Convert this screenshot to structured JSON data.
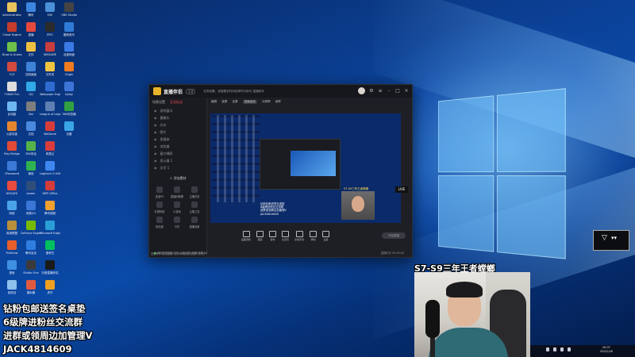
{
  "desktop_icons": [
    {
      "label": "Administrator",
      "color": "#e7c55c"
    },
    {
      "label": "Cheat Engine",
      "color": "#c43c2c"
    },
    {
      "label": "Draw & Guess",
      "color": "#6cc04a"
    },
    {
      "label": "V13",
      "color": "#d24a3f"
    },
    {
      "label": "736407?ol.",
      "color": "#dddddd"
    },
    {
      "label": "此电脑",
      "color": "#6fb7f0"
    },
    {
      "label": "火影忍者",
      "color": "#e5862f"
    },
    {
      "label": "Poly Bridge",
      "color": "#e04b37"
    },
    {
      "label": "1Password",
      "color": "#3b7ad6"
    },
    {
      "label": "NOSAFE",
      "color": "#e94a3f"
    },
    {
      "label": "网络",
      "color": "#4aa3e8"
    },
    {
      "label": "英雄联盟",
      "color": "#b7903b"
    },
    {
      "label": "ProShow",
      "color": "#e65f2c"
    },
    {
      "label": "搜索",
      "color": "#3f8fe2"
    },
    {
      "label": "回收站",
      "color": "#8ec0ee"
    },
    {
      "label": "腾讯",
      "color": "#3d86e0"
    },
    {
      "label": "直播",
      "color": "#e5483c"
    },
    {
      "label": "文件",
      "color": "#f0c040"
    },
    {
      "label": "控制面板",
      "color": "#3e82d8"
    },
    {
      "label": "QQ",
      "color": "#31a9e8"
    },
    {
      "label": "Zen",
      "color": "#7e7e7e"
    },
    {
      "label": "文档",
      "color": "#4b89e0"
    },
    {
      "label": "360安全",
      "color": "#55b34a"
    },
    {
      "label": "微信",
      "color": "#2fb350"
    },
    {
      "label": "steam",
      "color": "#2e4e7a"
    },
    {
      "label": "网易UU",
      "color": "#3a76d6"
    },
    {
      "label": "GeForce Experience",
      "color": "#76b900"
    },
    {
      "label": "腾讯会议",
      "color": "#2f7de1"
    },
    {
      "label": "Studio One",
      "color": "#3b3b3b"
    },
    {
      "label": "模拟器",
      "color": "#e15a3f"
    },
    {
      "label": "EVE",
      "color": "#4a90d9"
    },
    {
      "label": "EPIC",
      "color": "#2b2b2b"
    },
    {
      "label": "WEGAME",
      "color": "#c83d3d"
    },
    {
      "label": "文件夹",
      "color": "#f0c440"
    },
    {
      "label": "Wallpaper Engine",
      "color": "#2f6bd1"
    },
    {
      "label": "League of Legends",
      "color": "#5e7fb2"
    },
    {
      "label": "WeGame",
      "color": "#d63c3c"
    },
    {
      "label": "网易云",
      "color": "#d83c3c"
    },
    {
      "label": "Logitech G HUB",
      "color": "#3f87f0"
    },
    {
      "label": "WPS Office",
      "color": "#d43b3b"
    },
    {
      "label": "腾讯视频",
      "color": "#f0a030"
    },
    {
      "label": "Microsoft Edge",
      "color": "#2a9fd6"
    },
    {
      "label": "爱奇艺",
      "color": "#00c060"
    },
    {
      "label": "抖音直播伴侣",
      "color": "#1a1a1a"
    },
    {
      "label": "虎牙",
      "color": "#f0a020"
    },
    {
      "label": "OBS Studio",
      "color": "#444444"
    },
    {
      "label": "酷狗音乐",
      "color": "#2f7ad6"
    },
    {
      "label": "百度网盘",
      "color": "#3a7ae6"
    },
    {
      "label": "Origin",
      "color": "#f07a20"
    },
    {
      "label": "Uplay",
      "color": "#3d74d8"
    },
    {
      "label": "360浏览器",
      "color": "#30a040"
    },
    {
      "label": "迅雷",
      "color": "#3aa6e6"
    }
  ],
  "app": {
    "title": "直播伴侣",
    "version": "1.0",
    "notice": "礼物设置，依据更多时间选择时长即可    直播助手",
    "side_tabs": [
      "场景设置",
      "互动玩法"
    ],
    "sources": [
      "游戏窗口",
      "摄像头",
      "文本",
      "图片",
      "多媒体",
      "浏览器",
      "窗口捕获",
      "显示器 1",
      "文字 1"
    ],
    "add_source": "＋ 添加素材",
    "tools": [
      "连麦PK",
      "直播间管理",
      "主播任务",
      "礼物特效",
      "小游戏",
      "主播工具",
      "粉丝团",
      "分享",
      "直播设置"
    ],
    "side_footer": "直播帐号  保存直播内容到本地数据  直播时长统计",
    "preview_bar": [
      "横屏",
      "竖屏",
      "全屏",
      "直播画面",
      "分辨率",
      "帧率"
    ],
    "preview_caption": "S7-S9三年王者螳螂",
    "preview_text": "钻粉包邮送签名桌垫\n6级牌进粉丝交流群\n进群或领周边加管理V\nJACK4814609",
    "bottom_tools": [
      "画面调整",
      "美颜",
      "音效",
      "麦克风",
      "系统声音",
      "录制",
      "设置"
    ],
    "start_button": "开始直播",
    "status_ok": "●",
    "status": "网络状态良好  CPU 占用  内存  码率  帧率 60",
    "status_right": "直播时长 00:00:00"
  },
  "overlay": {
    "streamer_title": "S7-S9三年王者螳螂",
    "promo_lines": [
      "钻粉包邮送签名桌垫",
      "6级牌进粉丝交流群",
      "进群或领周边加管理V",
      "JACK4814609"
    ]
  },
  "mini_widget": {
    "glyph": "▽",
    "dots": "▾▾"
  },
  "cam_mini_label": "LIVE",
  "clock": {
    "time": "20:07",
    "date": "2022/1/8"
  }
}
